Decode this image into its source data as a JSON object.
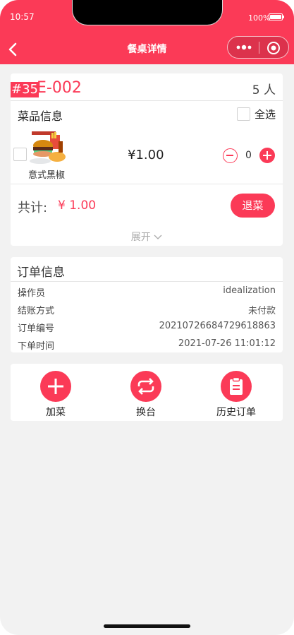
{
  "status_bar": {
    "time": "10:57",
    "battery": "100%"
  },
  "nav": {
    "title": "餐桌详情"
  },
  "table": {
    "number_badge": "#35",
    "code": "E-002",
    "guests": "5 人",
    "section_label": "菜品信息",
    "select_all_label": "全选",
    "dishes": [
      {
        "name": "意式黑椒",
        "price": "¥1.00",
        "quantity": "0"
      }
    ],
    "total_label": "共计:",
    "total_value": "¥ 1.00",
    "return_button": "退菜",
    "expand_label": "展开"
  },
  "order": {
    "title": "订单信息",
    "rows": [
      {
        "key": "操作员",
        "value": "idealization"
      },
      {
        "key": "结账方式",
        "value": "未付款"
      },
      {
        "key": "订单编号",
        "value": "20210726684729618863"
      },
      {
        "key": "下单时间",
        "value": "2021-07-26 11:01:12"
      }
    ]
  },
  "actions": [
    {
      "label": "加菜",
      "icon": "plus-icon"
    },
    {
      "label": "换台",
      "icon": "swap-icon"
    },
    {
      "label": "历史订单",
      "icon": "clipboard-icon"
    }
  ],
  "colors": {
    "accent": "#fb3a57",
    "background": "#f2f2f2"
  }
}
